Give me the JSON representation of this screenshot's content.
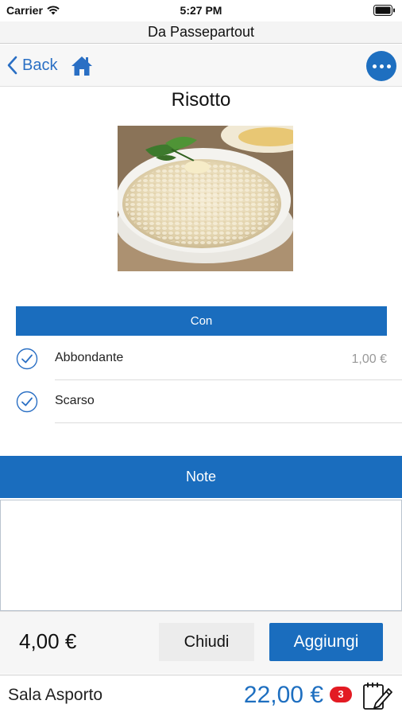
{
  "status_bar": {
    "carrier": "Carrier",
    "time": "5:27 PM"
  },
  "title_bar": {
    "title": "Da Passepartout"
  },
  "nav": {
    "back_label": "Back",
    "home_icon": "home-icon",
    "more_icon": "more-options-icon"
  },
  "dish": {
    "name": "Risotto"
  },
  "options": {
    "header": "Con",
    "items": [
      {
        "label": "Abbondante",
        "price": "1,00 €",
        "checked": true
      },
      {
        "label": "Scarso",
        "price": "",
        "checked": true
      }
    ]
  },
  "note": {
    "header": "Note",
    "value": ""
  },
  "action_bar": {
    "price": "4,00 €",
    "close_label": "Chiudi",
    "add_label": "Aggiungi"
  },
  "footer": {
    "room": "Sala Asporto",
    "total": "22,00 €",
    "badge_count": "3"
  },
  "colors": {
    "accent": "#1a6dbe",
    "badge": "#e31b23",
    "link": "#2a6fc4"
  }
}
